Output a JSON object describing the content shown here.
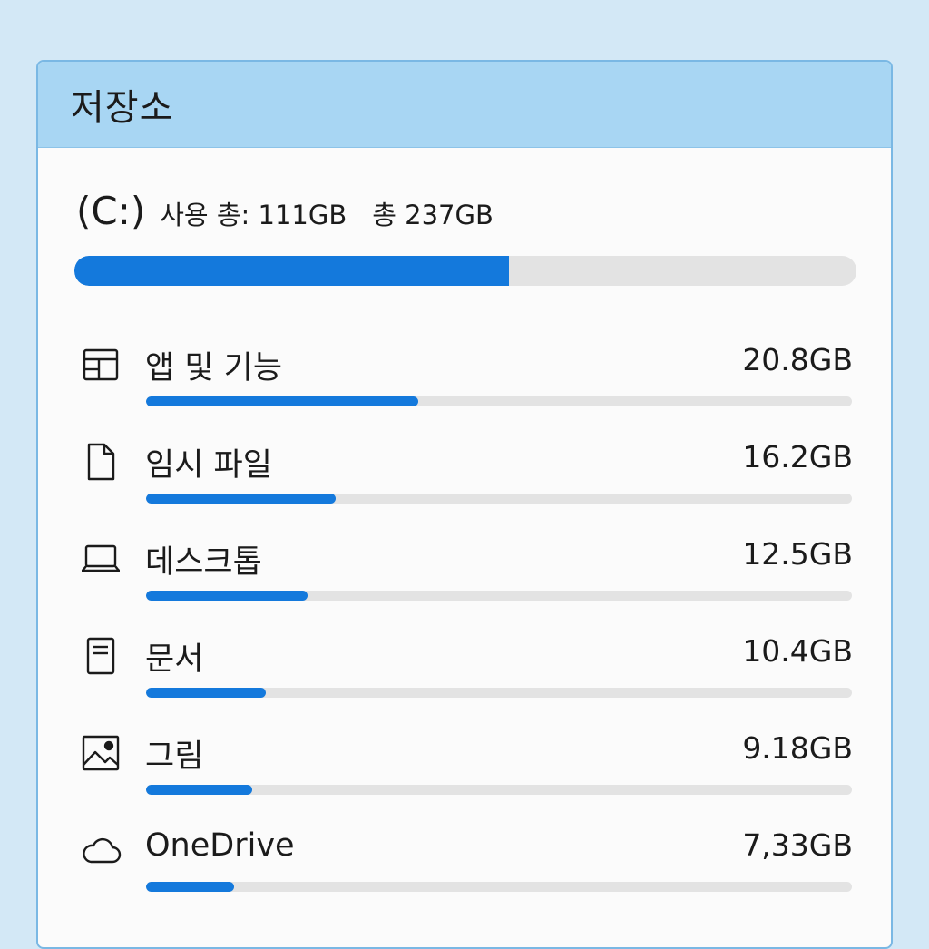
{
  "header": {
    "title": "저장소"
  },
  "drive": {
    "label": "(C:)",
    "used_text": "사용 총: 111GB",
    "total_text": "총 237GB",
    "used_fraction": 0.556
  },
  "categories": [
    {
      "label": "앱 및 기능",
      "size": "20.8GB",
      "icon": "apps-window-icon",
      "fill_fraction": 0.386
    },
    {
      "label": "임시 파일",
      "size": "16.2GB",
      "icon": "file-icon",
      "fill_fraction": 0.269
    },
    {
      "label": "데스크톱",
      "size": "12.5GB",
      "icon": "laptop-icon",
      "fill_fraction": 0.229
    },
    {
      "label": "문서",
      "size": "10.4GB",
      "icon": "document-icon",
      "fill_fraction": 0.17
    },
    {
      "label": "그림",
      "size": "9.18GB",
      "icon": "image-icon",
      "fill_fraction": 0.151
    },
    {
      "label": "OneDrive",
      "size": "7,33GB",
      "icon": "cloud-icon",
      "fill_fraction": 0.125
    }
  ],
  "colors": {
    "accent": "#1479dc",
    "track": "#e3e3e3",
    "header_bg": "#a8d6f3",
    "page_bg": "#d3e8f6"
  }
}
